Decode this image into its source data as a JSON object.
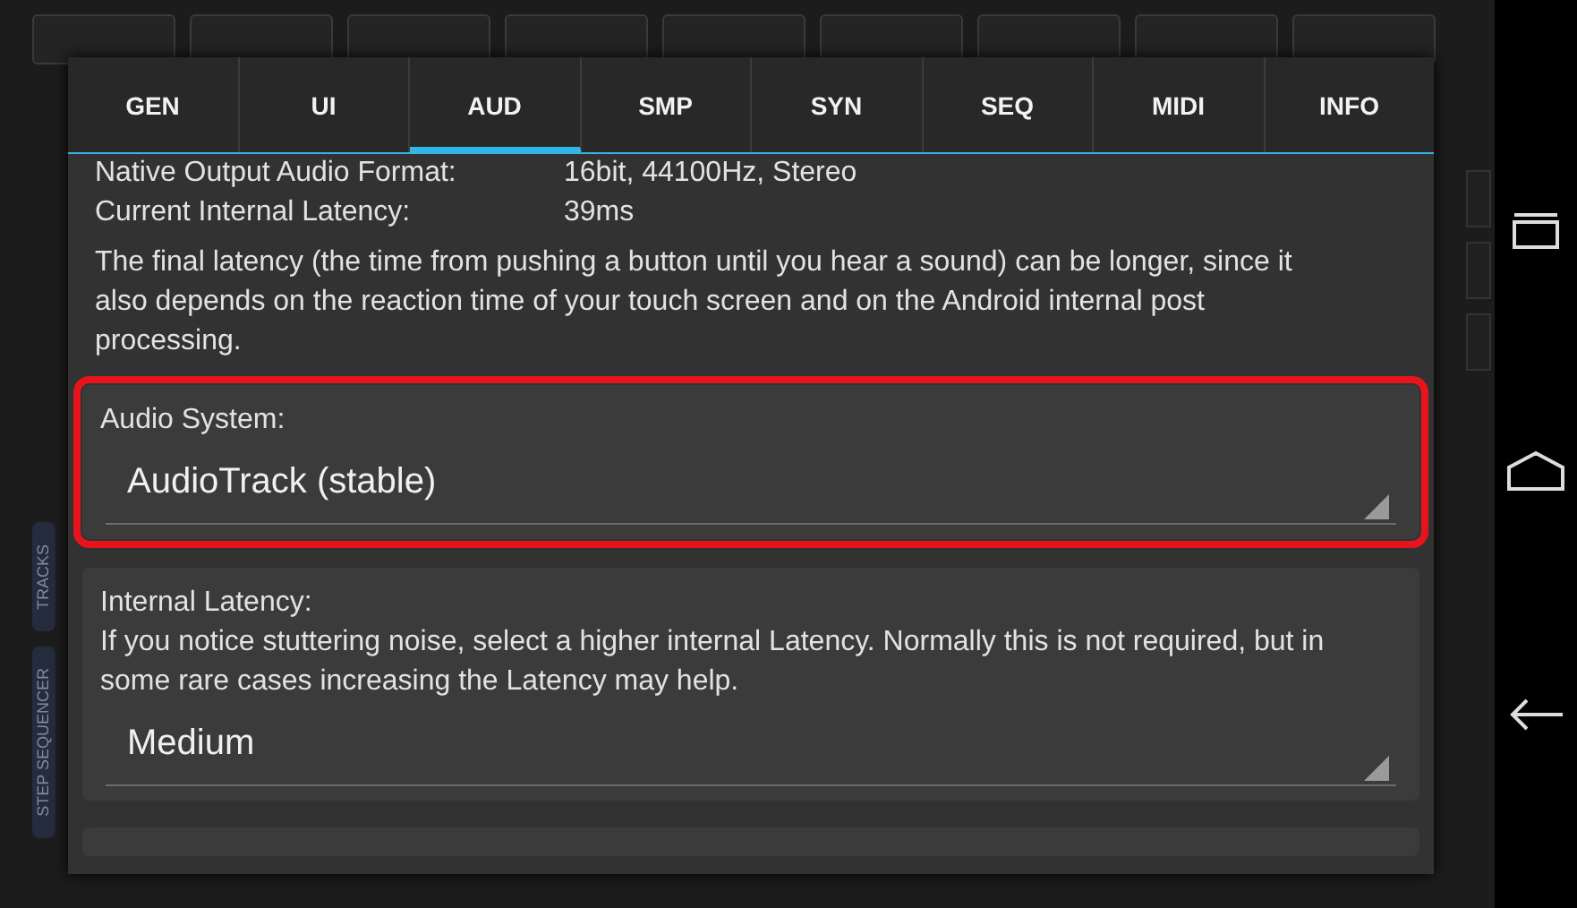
{
  "background": {
    "side_tabs": [
      "TRACKS",
      "STEP SEQUENCER"
    ]
  },
  "tabs": [
    {
      "label": "GEN",
      "selected": false
    },
    {
      "label": "UI",
      "selected": false
    },
    {
      "label": "AUD",
      "selected": true
    },
    {
      "label": "SMP",
      "selected": false
    },
    {
      "label": "SYN",
      "selected": false
    },
    {
      "label": "SEQ",
      "selected": false
    },
    {
      "label": "MIDI",
      "selected": false
    },
    {
      "label": "INFO",
      "selected": false
    }
  ],
  "info_rows": [
    {
      "label": "Native Output Audio Format:",
      "value": "16bit, 44100Hz, Stereo"
    },
    {
      "label": "Current Internal Latency:",
      "value": "39ms"
    }
  ],
  "note": "The final latency (the time from pushing a button until you hear a sound) can be longer, since it also depends on the reaction time of your touch screen and on the Android internal post processing.",
  "settings": [
    {
      "label": "Audio System:",
      "value": "AudioTrack (stable)",
      "highlighted": true
    },
    {
      "label": "Internal Latency:",
      "description": "If you notice stuttering noise, select a higher internal Latency. Normally this is not required, but in some rare cases increasing the Latency may help.",
      "value": "Medium",
      "highlighted": false
    }
  ]
}
